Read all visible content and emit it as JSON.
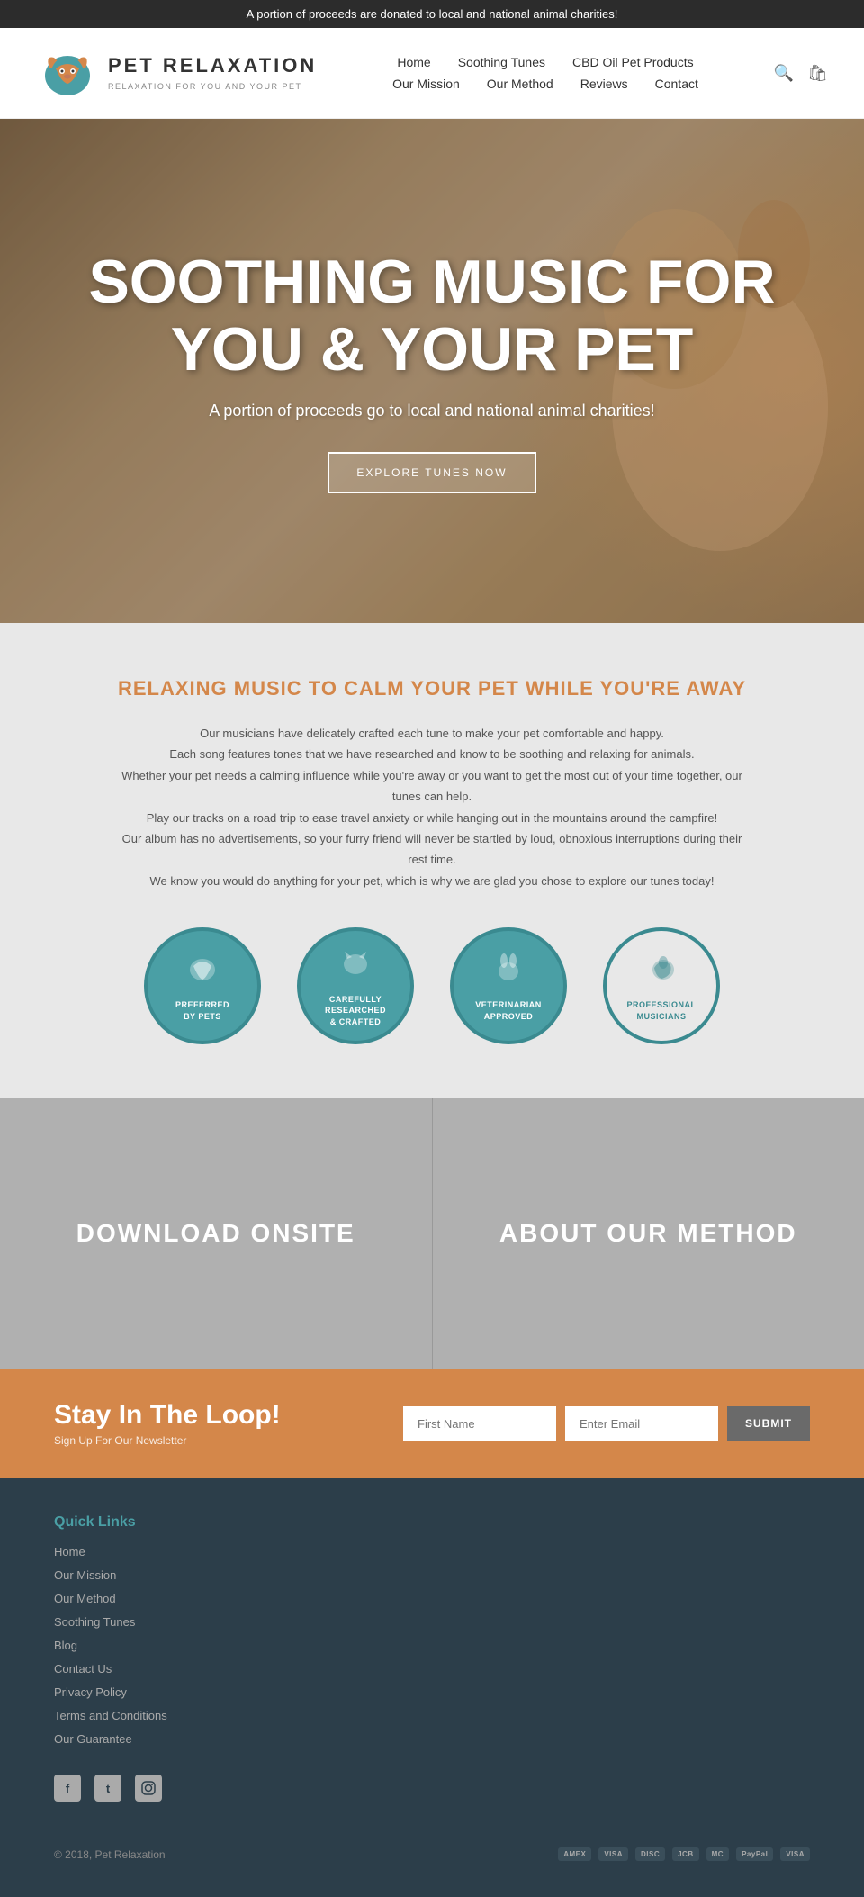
{
  "topBanner": {
    "text": "A portion of proceeds are donated to local and national animal charities!"
  },
  "header": {
    "logoName": "Pet RelaXation",
    "logoTagline": "RELAXATION FOR YOU AND YOUR PET",
    "nav": {
      "row1": [
        "Home",
        "Soothing Tunes",
        "CBD Oil Pet Products"
      ],
      "row2": [
        "Our Mission",
        "Our Method",
        "Reviews",
        "Contact"
      ]
    }
  },
  "hero": {
    "title": "SOOTHING MUSIC FOR YOU & YOUR PET",
    "subtitle": "A portion of proceeds go to local and national animal charities!",
    "buttonLabel": "EXPLORE TUNES NOW"
  },
  "infoSection": {
    "title": "RELAXING MUSIC TO CALM YOUR PET WHILE YOU'RE AWAY",
    "paragraphs": [
      "Our musicians have delicately crafted each tune to make your pet comfortable and happy.",
      "Each song features tones that we have researched and know to be soothing and relaxing for animals.",
      "Whether your pet needs a calming influence while you're away or you want to get the most out of your time together, our tunes can help.",
      "Play our tracks on a road trip to ease travel anxiety or while hanging out in the mountains around the campfire!",
      "Our album has no advertisements, so your furry friend will never be startled by loud, obnoxious interruptions during their rest time.",
      "We know you would do anything for your pet, which is why we are glad you chose to explore our tunes today!"
    ],
    "badges": [
      {
        "label": "PREFERRED BY PETS",
        "animal": "🐕"
      },
      {
        "label": "CAREFULLY RESEARCHED & CRAFTED",
        "animal": "🐈"
      },
      {
        "label": "VETERINARIAN APPROVED",
        "animal": "🐇"
      },
      {
        "label": "PROFESSIONAL MUSICIANS",
        "animal": "🐕"
      }
    ]
  },
  "splitSection": {
    "left": "DOWNLOAD ONSITE",
    "right": "ABOUT OUR METHOD"
  },
  "newsletter": {
    "heading": "Stay In The Loop!",
    "subtext": "Sign Up For Our Newsletter",
    "firstNamePlaceholder": "First Name",
    "emailPlaceholder": "Enter Email",
    "submitLabel": "SUBMIT"
  },
  "footer": {
    "quickLinksTitle": "Quick Links",
    "links": [
      "Home",
      "Our Mission",
      "Our Method",
      "Soothing Tunes",
      "Blog",
      "Contact Us",
      "Privacy Policy",
      "Terms and Conditions",
      "Our Guarantee"
    ],
    "socialIcons": [
      "f",
      "t",
      "i"
    ],
    "copyright": "© 2018, Pet Relaxation",
    "paymentMethods": [
      "AMEX",
      "VISA",
      "DISC",
      "JCB",
      "MC",
      "PayPal",
      "VISA"
    ]
  }
}
